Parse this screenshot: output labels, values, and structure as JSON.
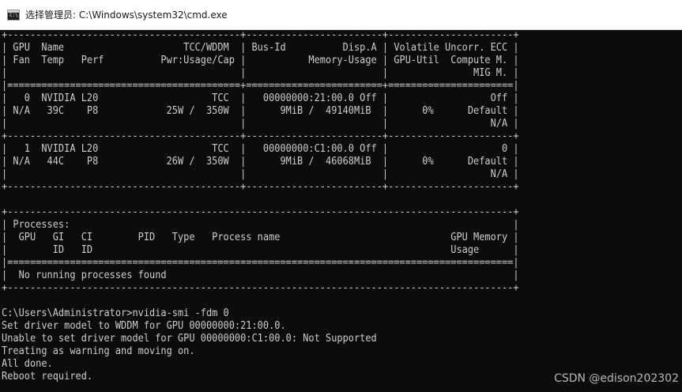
{
  "window": {
    "title": "选择管理员: C:\\Windows\\system32\\cmd.exe",
    "icon": "cmd-console-icon",
    "icon_glyph": "C:\\"
  },
  "console": {
    "foreground": "#cccccc",
    "background": "#0c0c0c",
    "lines": [
      "+-----------------------------------------+------------------------+----------------------+",
      "| GPU  Name                     TCC/WDDM  | Bus-Id          Disp.A | Volatile Uncorr. ECC |",
      "| Fan  Temp   Perf          Pwr:Usage/Cap |           Memory-Usage | GPU-Util  Compute M. |",
      "|                                         |                        |               MIG M. |",
      "|=========================================+========================+======================|",
      "|   0  NVIDIA L20                    TCC  |   00000000:21:00.0 Off |                  Off |",
      "| N/A   39C    P8            25W /  350W  |      9MiB /  49140MiB  |      0%      Default |",
      "|                                         |                        |                  N/A |",
      "+-----------------------------------------+------------------------+----------------------+",
      "|   1  NVIDIA L20                    TCC  |   00000000:C1:00.0 Off |                    0 |",
      "| N/A   44C    P8            26W /  350W  |      9MiB /  46068MiB  |      0%      Default |",
      "|                                         |                        |                  N/A |",
      "+-----------------------------------------+------------------------+----------------------+",
      "",
      "+-----------------------------------------------------------------------------------------+",
      "| Processes:                                                                              |",
      "|  GPU   GI   CI        PID   Type   Process name                              GPU Memory |",
      "|        ID   ID                                                               Usage      |",
      "|=========================================================================================|",
      "|  No running processes found                                                             |",
      "+-----------------------------------------------------------------------------------------+",
      "",
      "C:\\Users\\Administrator>nvidia-smi -fdm 0",
      "Set driver model to WDDM for GPU 00000000:21:00.0.",
      "Unable to set driver model for GPU 00000000:C1:00.0: Not Supported",
      "Treating as warning and moving on.",
      "All done.",
      "Reboot required."
    ]
  },
  "watermark": {
    "text": "CSDN @edison202302"
  }
}
